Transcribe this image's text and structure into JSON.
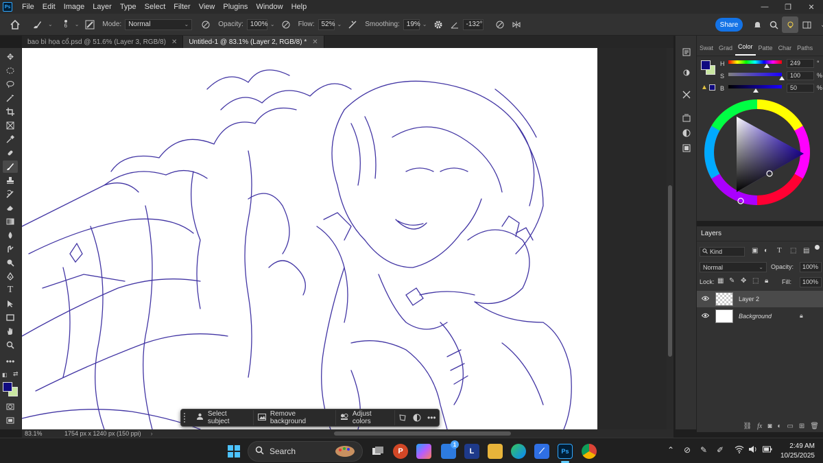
{
  "app": {
    "logo": "Ps"
  },
  "menu": [
    "File",
    "Edit",
    "Image",
    "Layer",
    "Type",
    "Select",
    "Filter",
    "View",
    "Plugins",
    "Window",
    "Help"
  ],
  "window_controls": {
    "minimize": "—",
    "restore": "❐",
    "close": "✕"
  },
  "options": {
    "brush_size": "6",
    "mode_label": "Mode:",
    "mode_value": "Normal",
    "opacity_label": "Opacity:",
    "opacity_value": "100%",
    "flow_label": "Flow:",
    "flow_value": "52%",
    "smoothing_label": "Smoothing:",
    "smoothing_value": "19%",
    "angle_value": "-132°",
    "share_label": "Share"
  },
  "tabs": [
    {
      "label": "bao bì họa cổ.psd @ 51.6% (Layer 3, RGB/8)",
      "close": "✕"
    },
    {
      "label": "Untitled-1 @ 83.1% (Layer 2, RGB/8) *",
      "close": "✕"
    }
  ],
  "status": {
    "zoom": "83.1%",
    "dims": "1754 px x 1240 px (150 ppi)",
    "chev": "›"
  },
  "context_bar": {
    "select_subject": "Select subject",
    "remove_background": "Remove background",
    "adjust_colors": "Adjust colors"
  },
  "color_panel": {
    "tabs": [
      "Swat",
      "Grad",
      "Color",
      "Patte",
      "Char",
      "Paths"
    ],
    "h_label": "H",
    "h_value": "249",
    "h_unit": "°",
    "s_label": "S",
    "s_value": "100",
    "s_unit": "%",
    "b_label": "B",
    "b_value": "50",
    "b_unit": "%",
    "fg_color": "#100a80",
    "bg_color": "#c8e6a0"
  },
  "layers_panel": {
    "title": "Layers",
    "kind_label": "Kind",
    "blend_mode": "Normal",
    "opacity_label": "Opacity:",
    "opacity_value": "100%",
    "lock_label": "Lock:",
    "fill_label": "Fill:",
    "fill_value": "100%",
    "layers": [
      {
        "name": "Layer 2",
        "selected": true
      },
      {
        "name": "Background",
        "selected": false
      }
    ]
  },
  "taskbar": {
    "search_label": "Search",
    "time": "2:49 AM",
    "date": "10/25/2025",
    "store_badge": "1"
  },
  "icons": {
    "home": "home-icon",
    "brush": "brush-icon",
    "settings": "gear-icon",
    "notifications": "bell-icon",
    "search": "search-icon"
  }
}
